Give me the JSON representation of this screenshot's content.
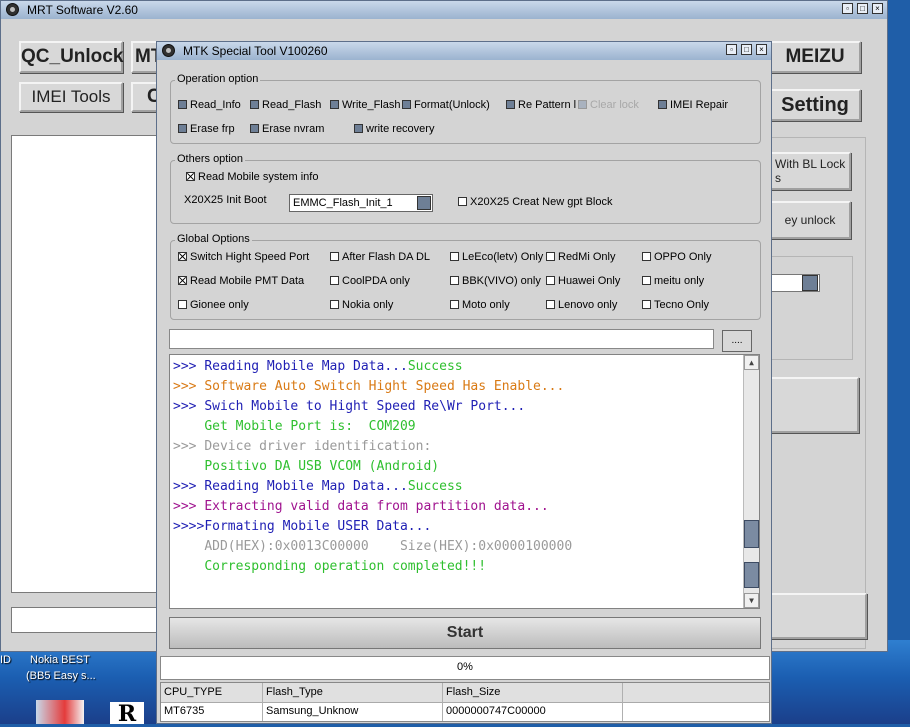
{
  "desktop": {
    "icon_labels": [
      "ID",
      "Nokia BEST",
      "(BB5 Easy s..."
    ]
  },
  "main_window": {
    "title": "MRT Software V2.60",
    "buttons": {
      "qc_unlock": "QC_Unlock",
      "mt_partial": "MT",
      "meizu": "MEIZU",
      "imei_tools": "IMEI Tools",
      "c_partial": "C",
      "setting": "Setting",
      "with_bl_lock": "With BL Lock",
      "with_bl_lock_line2": "s",
      "key_unlock": "ey unlock"
    }
  },
  "tool_window": {
    "title": "MTK Special Tool V100260",
    "operation_option": {
      "legend": "Operation option",
      "items": [
        {
          "label": "Read_Info",
          "checked": false
        },
        {
          "label": "Read_Flash",
          "checked": false
        },
        {
          "label": "Write_Flash",
          "checked": false
        },
        {
          "label": "Format(Unlock)",
          "checked": false
        },
        {
          "label": "Re Pattern lo",
          "checked": false
        },
        {
          "label": "Clear lock",
          "checked": false,
          "disabled": true
        },
        {
          "label": "IMEI Repair",
          "checked": false
        },
        {
          "label": "Erase frp",
          "checked": false
        },
        {
          "label": "Erase nvram",
          "checked": false
        },
        {
          "label": "write recovery",
          "checked": false
        }
      ]
    },
    "others_option": {
      "legend": "Others option",
      "read_mobile_system_info": "Read Mobile system info",
      "init_boot_label": "X20X25 Init Boot",
      "init_boot_value": "EMMC_Flash_Init_1",
      "creat_gpt_label": "X20X25 Creat New gpt Block"
    },
    "global_options": {
      "legend": "Global Options",
      "items": [
        {
          "label": "Switch Hight Speed Port",
          "checked": true
        },
        {
          "label": "After Flash DA DL",
          "checked": false
        },
        {
          "label": "LeEco(letv) Only",
          "checked": false
        },
        {
          "label": "RedMi Only",
          "checked": false
        },
        {
          "label": "OPPO Only",
          "checked": false
        },
        {
          "label": "Read Mobile PMT Data",
          "checked": true
        },
        {
          "label": "CoolPDA only",
          "checked": false
        },
        {
          "label": "BBK(VIVO) only",
          "checked": false
        },
        {
          "label": "Huawei Only",
          "checked": false
        },
        {
          "label": "meitu only",
          "checked": false
        },
        {
          "label": "Gionee only",
          "checked": false
        },
        {
          "label": "Nokia only",
          "checked": false
        },
        {
          "label": "Moto only",
          "checked": false
        },
        {
          "label": "Lenovo only",
          "checked": false
        },
        {
          "label": "Tecno Only",
          "checked": false
        }
      ]
    },
    "path_input_value": "",
    "browse_button": "....",
    "log": [
      {
        "prefix": ">>> ",
        "text": "Reading Mobile Map Data...",
        "suffix": "Success",
        "color": "#1f1fb4",
        "suffix_color": "#2fbf2f"
      },
      {
        "prefix": ">>> ",
        "text": "Software Auto Switch Hight Speed Has Enable...",
        "suffix": "",
        "color": "#d97a14",
        "suffix_color": ""
      },
      {
        "prefix": ">>> ",
        "text": "Swich Mobile to Hight Speed Re\\Wr Port...",
        "suffix": "",
        "color": "#1f1fb4",
        "suffix_color": ""
      },
      {
        "prefix": "    ",
        "text": "Get Mobile Port is:  COM209",
        "suffix": "",
        "color": "#2fbf2f",
        "suffix_color": ""
      },
      {
        "prefix": ">>> ",
        "text": "Device driver identification:",
        "suffix": "",
        "color": "#9a9a9a",
        "suffix_color": ""
      },
      {
        "prefix": "    ",
        "text": "Positivo DA USB VCOM (Android)",
        "suffix": "",
        "color": "#2fbf2f",
        "suffix_color": ""
      },
      {
        "prefix": ">>> ",
        "text": "Reading Mobile Map Data...",
        "suffix": "Success",
        "color": "#1f1fb4",
        "suffix_color": "#2fbf2f"
      },
      {
        "prefix": ">>> ",
        "text": "Extracting valid data from partition data...",
        "suffix": "",
        "color": "#a0138f",
        "suffix_color": ""
      },
      {
        "prefix": ">>>>",
        "text": "Formating Mobile USER Data...",
        "suffix": "",
        "color": "#1f1fb4",
        "suffix_color": ""
      },
      {
        "prefix": "    ",
        "text": "ADD(HEX):0x0013C00000    Size(HEX):0x0000100000",
        "suffix": "",
        "color": "#9a9a9a",
        "suffix_color": ""
      },
      {
        "prefix": "    ",
        "text": "Corresponding operation completed!!!",
        "suffix": "",
        "color": "#2fbf2f",
        "suffix_color": ""
      }
    ],
    "start_button": "Start",
    "progress": {
      "text": "0%",
      "value": 0
    },
    "table": {
      "headers": [
        "CPU_TYPE",
        "Flash_Type",
        "Flash_Size",
        ""
      ],
      "row": [
        "MT6735",
        "Samsung_Unknow",
        "0000000747C00000",
        ""
      ]
    }
  },
  "colors": {
    "title_bar": "#9bb3cf",
    "checkbox_unchecked": "#6e7f96",
    "scroll_thumb": "#7b8ba2"
  }
}
